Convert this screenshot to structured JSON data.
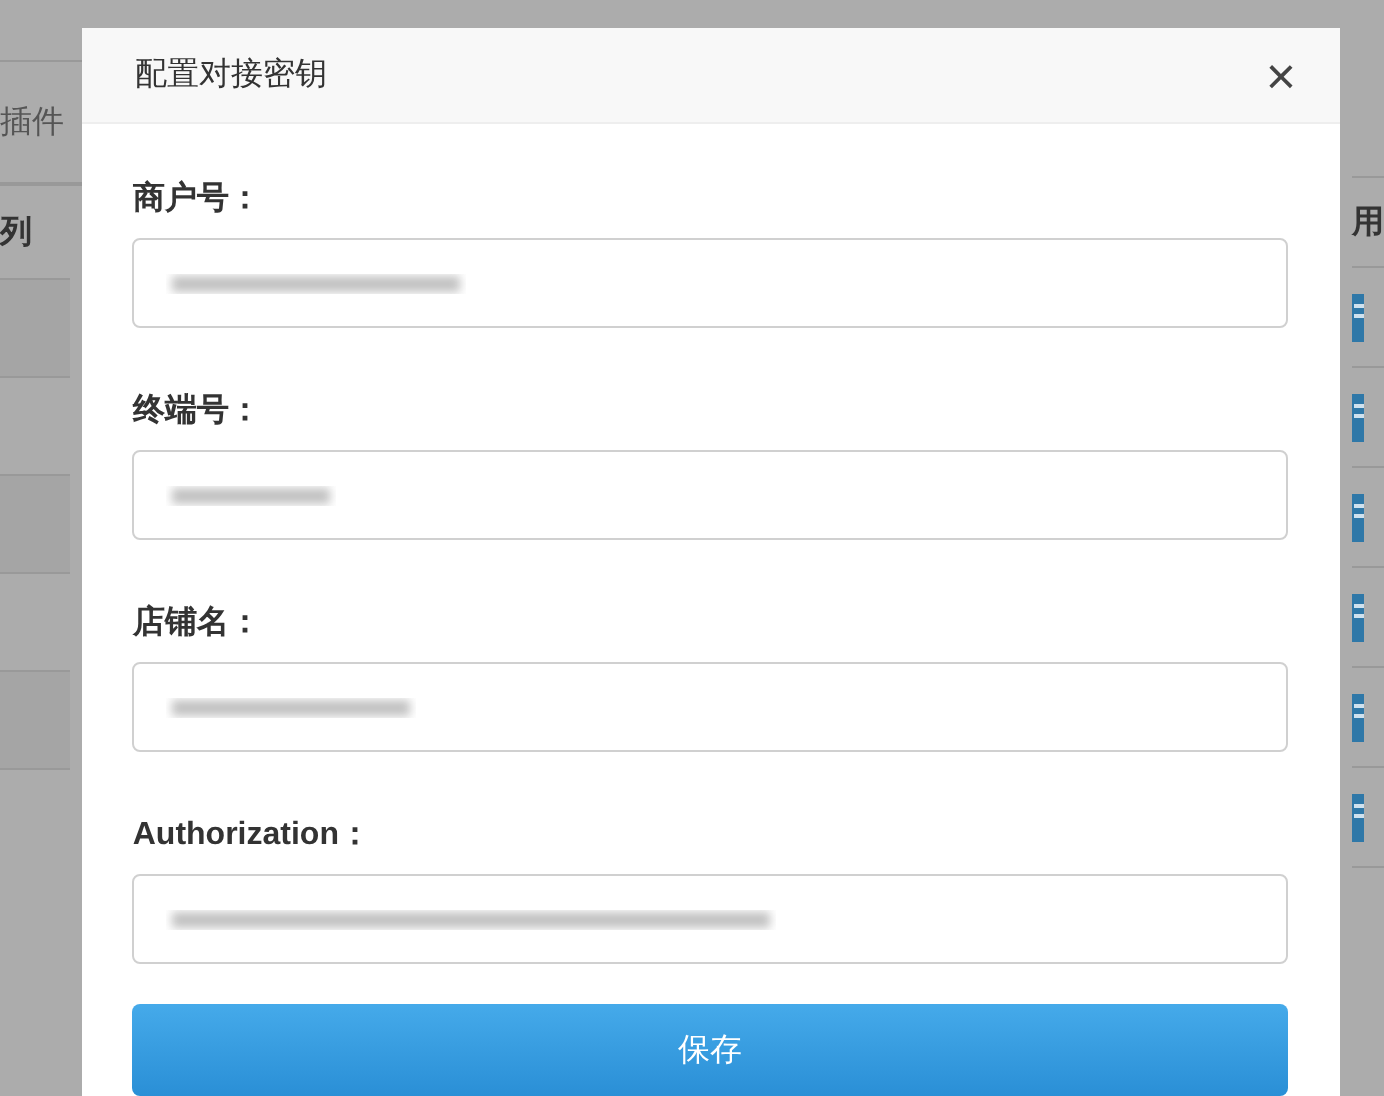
{
  "background": {
    "left_items": [
      {
        "label": "插件",
        "kind": "text"
      },
      {
        "label": "列",
        "kind": "heading"
      }
    ],
    "right_header": "用",
    "right_rows": [
      {
        "kind": "icon"
      },
      {
        "kind": "icon"
      },
      {
        "kind": "icon"
      },
      {
        "kind": "icon"
      },
      {
        "kind": "icon"
      },
      {
        "kind": "icon"
      }
    ]
  },
  "dialog": {
    "title": "配置对接密钥",
    "close": "×",
    "fields": [
      {
        "label": "商户号：",
        "value_blurred": true
      },
      {
        "label": "终端号：",
        "value_blurred": true
      },
      {
        "label": "店铺名：",
        "value_blurred": true
      },
      {
        "label": "Authorization：",
        "value_blurred": true
      }
    ],
    "submit": "保存"
  }
}
